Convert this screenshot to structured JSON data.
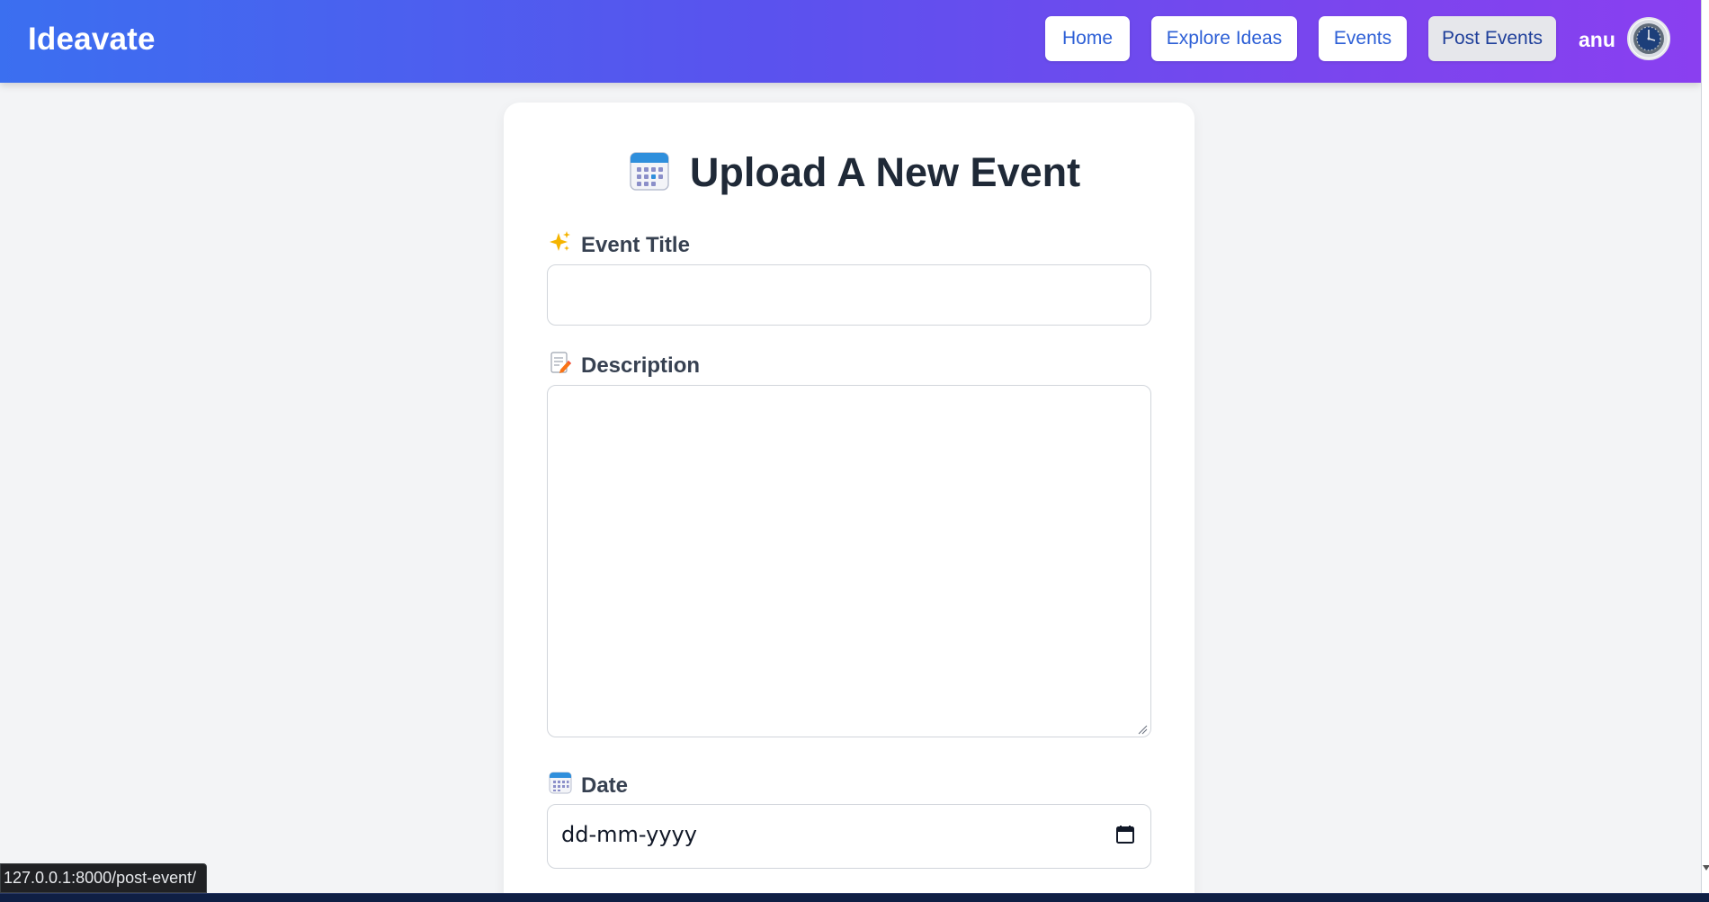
{
  "header": {
    "brand": "Ideavate",
    "nav": [
      {
        "label": "Home"
      },
      {
        "label": "Explore Ideas"
      },
      {
        "label": "Events"
      },
      {
        "label": "Post Events",
        "active": true
      }
    ],
    "username": "anu",
    "avatar_icon": "watch-avatar-icon"
  },
  "form": {
    "title": "Upload A New Event",
    "title_icon": "calendar-icon",
    "fields": {
      "event_title": {
        "label": "Event Title",
        "icon": "sparkles-icon",
        "value": ""
      },
      "description": {
        "label": "Description",
        "icon": "memo-icon",
        "value": ""
      },
      "date": {
        "label": "Date",
        "icon": "calendar-icon",
        "placeholder": "dd-mm-yyyy"
      }
    }
  },
  "statusbar": {
    "url": "127.0.0.1:8000/post-event/"
  },
  "colors": {
    "gradient_start": "#3b6ff0",
    "gradient_end": "#8a3ff0",
    "nav_text": "#2d5fd6",
    "background": "#f3f4f6"
  }
}
